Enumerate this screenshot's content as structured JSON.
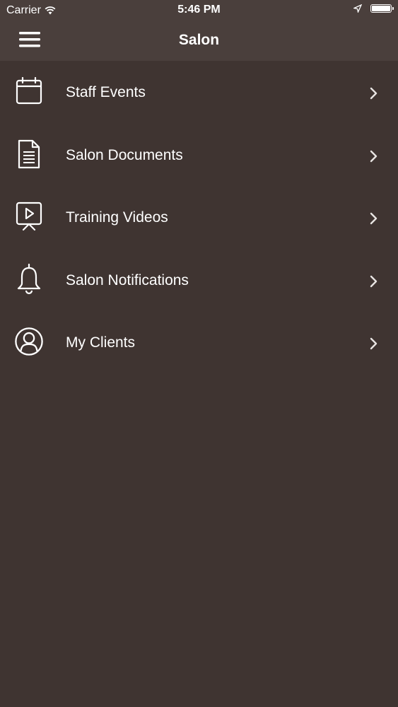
{
  "status_bar": {
    "carrier": "Carrier",
    "time": "5:46 PM"
  },
  "nav": {
    "title": "Salon",
    "menu_icon": "hamburger-menu-icon"
  },
  "menu_items": [
    {
      "label": "Staff Events",
      "icon": "calendar-icon"
    },
    {
      "label": "Salon Documents",
      "icon": "document-icon"
    },
    {
      "label": "Training Videos",
      "icon": "video-play-icon"
    },
    {
      "label": "Salon Notifications",
      "icon": "bell-icon"
    },
    {
      "label": "My Clients",
      "icon": "user-circle-icon"
    }
  ],
  "colors": {
    "background": "#3f3431",
    "header": "#4a3f3c",
    "text": "#ffffff"
  }
}
